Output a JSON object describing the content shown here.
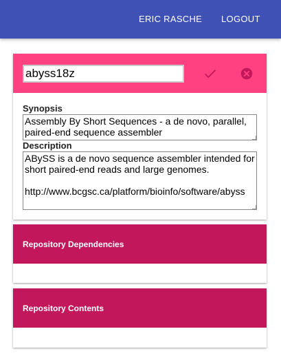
{
  "header": {
    "user_label": "ERIC RASCHE",
    "logout_label": "LOGOUT",
    "color": "#3f51b5"
  },
  "repository": {
    "name": "abyss18z",
    "synopsis_label": "Synopsis",
    "synopsis": "Assembly By Short Sequences - a de novo, parallel, paired-end sequence assembler",
    "description_label": "Description",
    "description": "ABySS is a de novo sequence assembler intended for short paired-end reads and large genomes.\n\nhttp://www.bcgsc.ca/platform/bioinfo/software/abyss",
    "title_bar_color": "#ff4081",
    "confirm_icon": "check-icon",
    "cancel_icon": "close-circle-icon"
  },
  "sections": {
    "dependencies_title": "Repository Dependencies",
    "contents_title": "Repository Contents",
    "color": "#c2185b"
  }
}
